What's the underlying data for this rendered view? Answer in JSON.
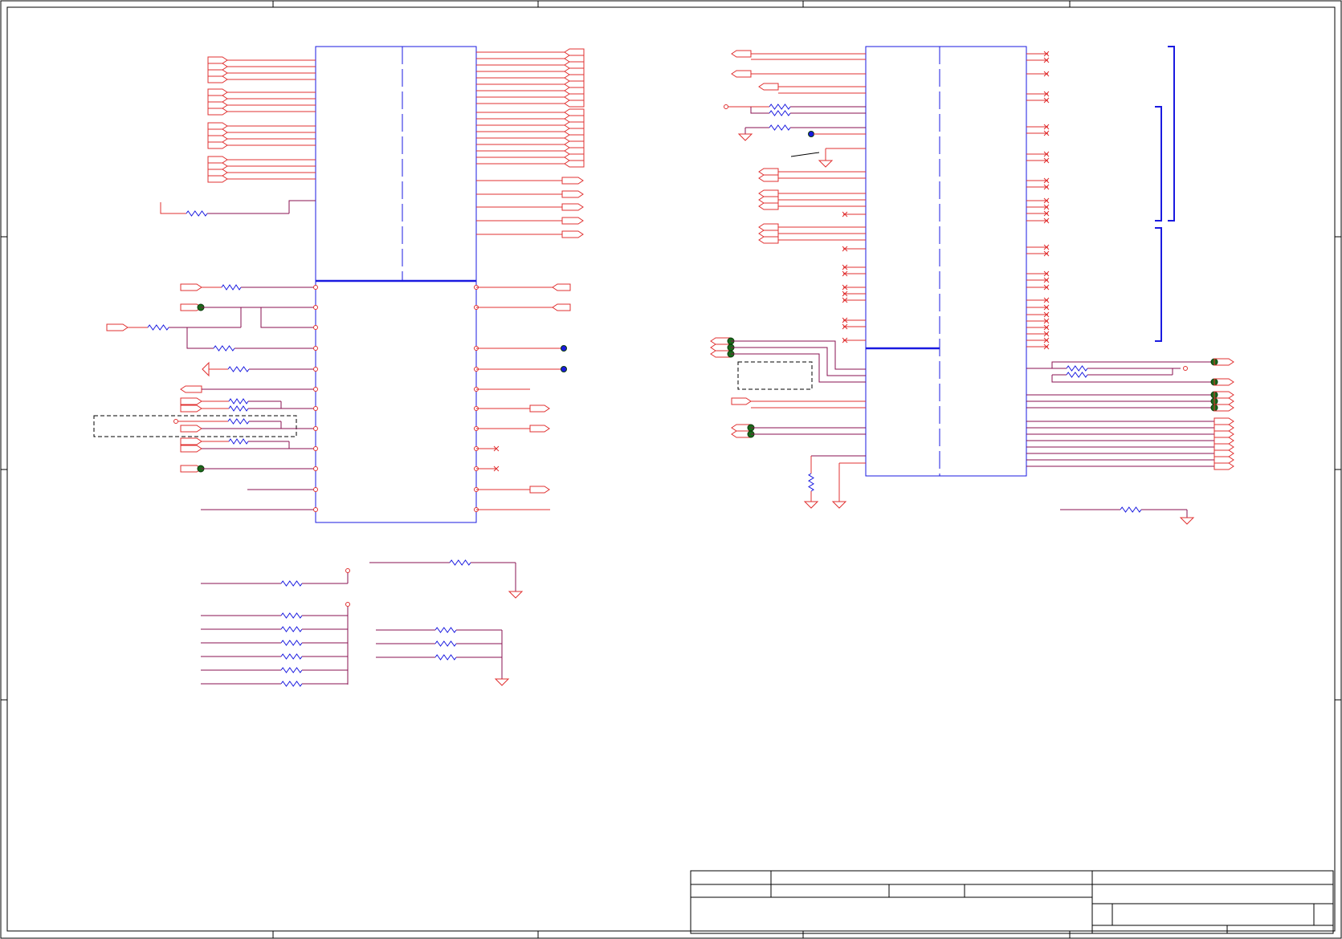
{
  "sheet": {
    "title": "",
    "page_color": "#ffffff"
  },
  "colors": {
    "frame": "#000000",
    "component_body": "#1a1ae0",
    "wire": "#e03030",
    "net_wire": "#8a1050",
    "junction": "#1a6a1a",
    "pin_dot": "#d020d0"
  },
  "title_block": {
    "cells": [
      "",
      "",
      "",
      "",
      "",
      "",
      "",
      "",
      ""
    ]
  }
}
